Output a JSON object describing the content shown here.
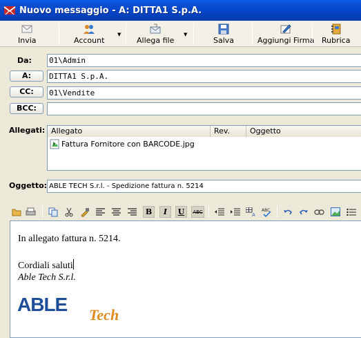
{
  "window": {
    "title": "Nuovo messaggio - A: DITTA1 S.p.A."
  },
  "toolbar": {
    "send": "Invia",
    "account": "Account",
    "attach": "Allega file",
    "save": "Salva",
    "add_signature": "Aggiungi Firma",
    "address_book": "Rubrica"
  },
  "fields": {
    "from_label": "Da:",
    "from_value": "01\\Admin",
    "to_label": "A:",
    "to_value": "DITTA1 S.p.A.",
    "cc_label": "CC:",
    "cc_value": "01\\Vendite",
    "bcc_label": "BCC:",
    "bcc_value": "",
    "attachments_label": "Allegati:",
    "subject_label": "Oggetto:",
    "subject_value": "ABLE TECH S.r.l. - Spedizione fattura n. 5214"
  },
  "attachments": {
    "columns": [
      "Allegato",
      "Rev.",
      "Oggetto"
    ],
    "rows": [
      {
        "name": "Fattura Fornitore con BARCODE.jpg",
        "rev": "",
        "subject": ""
      }
    ]
  },
  "format_toolbar": {
    "bold": "B",
    "italic": "I",
    "underline": "U",
    "strike": "ABC"
  },
  "body": {
    "line1": "In allegato fattura n. 5214.",
    "line2": "Cordiali saluti",
    "signature": "Able Tech S.r.l.",
    "logo_main": "ABLE",
    "logo_script": "Tech"
  },
  "colors": {
    "titlebar": "#0A53D8",
    "logo_blue": "#1E4E9A",
    "logo_orange": "#E08A1E"
  }
}
